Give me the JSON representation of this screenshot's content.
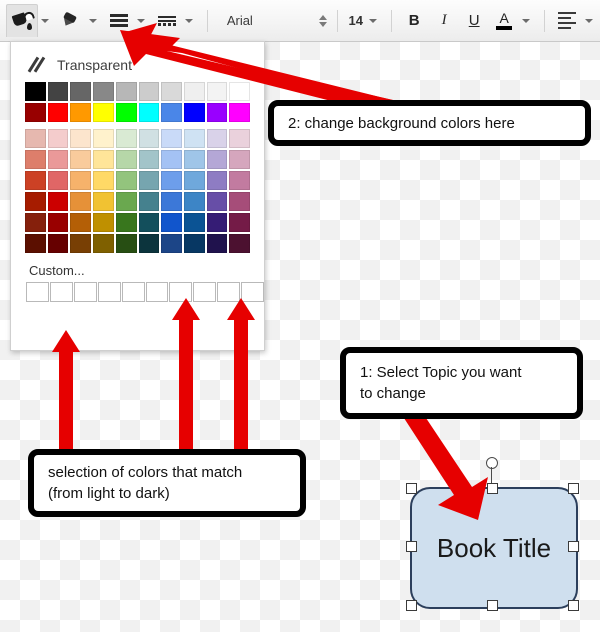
{
  "app": {
    "background": "transparency-checkerboard"
  },
  "toolbar": {
    "fill_color_icon": "paint-bucket-icon",
    "line_color_icon": "pen-icon",
    "line_weight_icon": "line-weight-icon",
    "line_dash_icon": "line-dash-icon",
    "font_family": "Arial",
    "font_size": "14",
    "bold_label": "B",
    "italic_label": "I",
    "underline_label": "U",
    "text_color_label": "A",
    "align_icon": "align-left-icon",
    "dropdown_caret_icon": "chevron-down-icon",
    "spinner_icon": "spinner-up-down-icon"
  },
  "palette": {
    "transparent_label": "Transparent",
    "transparent_icon": "transparent-slash-icon",
    "custom_label": "Custom...",
    "grayscale_row": [
      "#000000",
      "#434343",
      "#666666",
      "#888888",
      "#b7b7b7",
      "#cccccc",
      "#d9d9d9",
      "#efefef",
      "#f3f3f3",
      "#ffffff"
    ],
    "standard_row": [
      "#980000",
      "#ff0000",
      "#ff9900",
      "#ffff00",
      "#00ff00",
      "#00ffff",
      "#4a86e8",
      "#0000ff",
      "#9900ff",
      "#ff00ff"
    ],
    "tint_rows": [
      [
        "#e6b8af",
        "#f4cccc",
        "#fce5cd",
        "#fff2cc",
        "#d9ead3",
        "#d0e0e3",
        "#c9daf8",
        "#cfe2f3",
        "#d9d2e9",
        "#ead1dc"
      ],
      [
        "#dd7e6b",
        "#ea9999",
        "#f9cb9c",
        "#ffe599",
        "#b6d7a8",
        "#a2c4c9",
        "#a4c2f4",
        "#9fc5e8",
        "#b4a7d6",
        "#d5a6bd"
      ],
      [
        "#cc4125",
        "#e06666",
        "#f6b26b",
        "#ffd966",
        "#93c47d",
        "#76a5af",
        "#6d9eeb",
        "#6fa8dc",
        "#8e7cc3",
        "#c27ba0"
      ],
      [
        "#a61c00",
        "#cc0000",
        "#e69138",
        "#f1c232",
        "#6aa84f",
        "#45818e",
        "#3c78d8",
        "#3d85c6",
        "#674ea7",
        "#a64d79"
      ],
      [
        "#85200c",
        "#990000",
        "#b45f06",
        "#bf9000",
        "#38761d",
        "#134f5c",
        "#1155cc",
        "#0b5394",
        "#351c75",
        "#741b47"
      ],
      [
        "#5b0f00",
        "#660000",
        "#783f04",
        "#7f6000",
        "#274e13",
        "#0c343d",
        "#1c4587",
        "#073763",
        "#20124d",
        "#4c1130"
      ]
    ],
    "custom_slot_count": 10
  },
  "callouts": {
    "callout_2": "2: change background colors here",
    "callout_1_line1": "1: Select Topic you want",
    "callout_1_line2": "to change",
    "callout_3_line1": "selection of colors that match",
    "callout_3_line2": "(from light to dark)"
  },
  "arrows": {
    "color": "#e60000",
    "diagonal_to_toolbar": "arrow-pointing-to-fill-color-tool",
    "vertical_left": "arrow-pointing-to-light-swatches",
    "vertical_mid": "arrow-pointing-to-mid-swatches",
    "vertical_right": "arrow-pointing-to-dark-swatches",
    "to_shape": "arrow-pointing-to-selected-shape"
  },
  "shape": {
    "label": "Book Title",
    "fill": "#cfdfee",
    "border": "#2c3f5c",
    "selected": true,
    "handle_count": 8,
    "rotate_handle": "rotation-handle"
  }
}
